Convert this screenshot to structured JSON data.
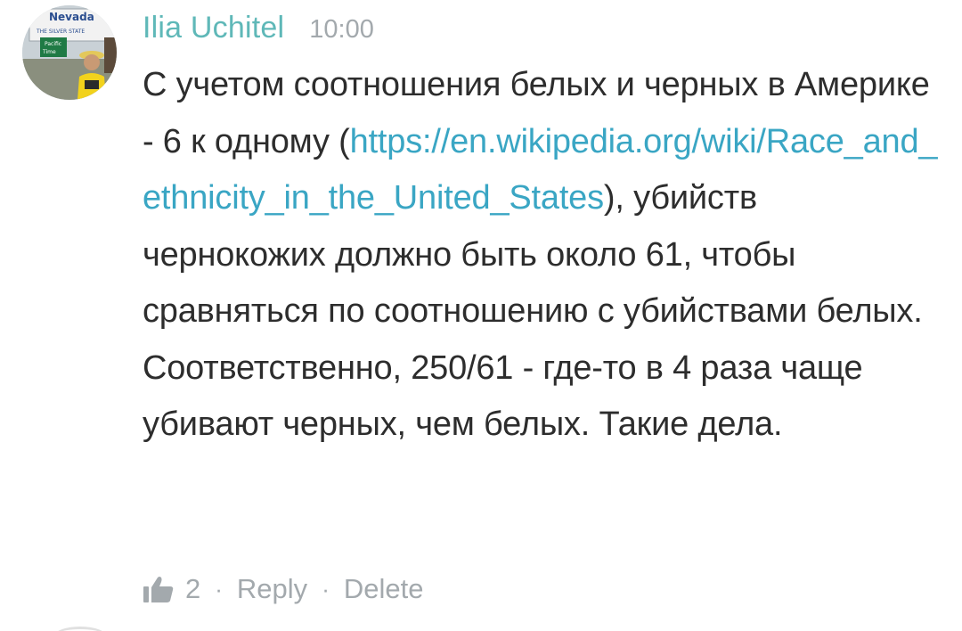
{
  "comment": {
    "avatar": {
      "icon": "user-avatar-photo",
      "sign_lines": [
        "Nevada",
        "THE SILVER STATE",
        "Pacific",
        "Time"
      ]
    },
    "author": "Ilia Uchitel",
    "time": "10:00",
    "body": {
      "text_before_link": "С учетом соотношения белых и черных в Америке - 6 к одному (",
      "link_text": "https://en.wikipedia.org/wiki/Race_and_ethnicity_in_the_United_States",
      "text_after_link": "), убийств чернокожих должно быть около 61, чтобы сравняться по соотношению с убийствами белых. Соответственно, 250/61 - где-то в 4 раза чаще убивают черных, чем белых. Такие дела."
    },
    "actions": {
      "like_icon": "thumbs-up-icon",
      "like_count": "2",
      "separator": "·",
      "reply_label": "Reply",
      "delete_label": "Delete"
    }
  },
  "colors": {
    "author": "#5fb8b8",
    "link": "#3aa6c4",
    "muted": "#a3a9ad",
    "body_text": "#2d2d2d"
  }
}
